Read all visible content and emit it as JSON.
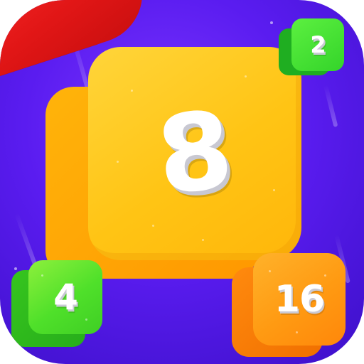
{
  "tiles": {
    "main": {
      "value": "8",
      "color": "#ffc20e"
    },
    "top_right": {
      "value": "2",
      "color": "#3ddc2c"
    },
    "bottom_left": {
      "value": "4",
      "color": "#4fe02a"
    },
    "bottom_right": {
      "value": "16",
      "color": "#ff9a12"
    }
  },
  "colors": {
    "background": "#5a1cf0",
    "red_shape": "#e11616"
  }
}
